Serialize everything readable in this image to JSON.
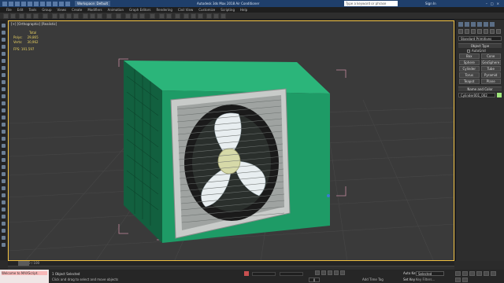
{
  "titlebar": {
    "workspace": "Workspace: Default",
    "app_title": "Autodesk 3ds Max 2018   Air Conditioner",
    "search_placeholder": "Type a keyword or phrase",
    "signin": "Sign In"
  },
  "menubar": {
    "items": [
      "File",
      "Edit",
      "Tools",
      "Group",
      "Views",
      "Create",
      "Modifiers",
      "Animation",
      "Graph Editors",
      "Rendering",
      "Civil View",
      "Customize",
      "Scripting",
      "Help"
    ]
  },
  "viewport": {
    "label": "[+] [Orthographic] [Realistic]",
    "stats": {
      "total_label": "Total",
      "polys_label": "Polys:",
      "polys_value": "29,865",
      "verts_label": "Verts:",
      "verts_value": "30,962",
      "fps_label": "FPS:",
      "fps_value": "191.597"
    }
  },
  "command_panel": {
    "category": "Standard Primitives",
    "object_type_header": "Object Type",
    "autogrid": "AutoGrid",
    "buttons": [
      "Box",
      "Cone",
      "Sphere",
      "GeoSphere",
      "Cylinder",
      "Tube",
      "Torus",
      "Pyramid",
      "Teapot",
      "Plane"
    ],
    "name_color_header": "Name and Color",
    "object_name": "Cylinder001_002",
    "object_color": "#9ee57a"
  },
  "timeline": {
    "position": "0 / 100"
  },
  "statusbar": {
    "maxscript_line1": "Welcome to MAXScript.",
    "maxscript_line2": "",
    "selection_info": "1 Object Selected",
    "prompt": "Click and drag to select and move objects",
    "frame": "0",
    "auto_key": "Auto Key",
    "set_key": "Set Key",
    "selected": "Selected",
    "key_filters": "Key Filters...",
    "add_time_tag": "Add Time Tag"
  },
  "colors": {
    "unit_body": "#1e9b66",
    "grid": "#4a4a4a",
    "selection_bracket": "#c58aa0"
  }
}
